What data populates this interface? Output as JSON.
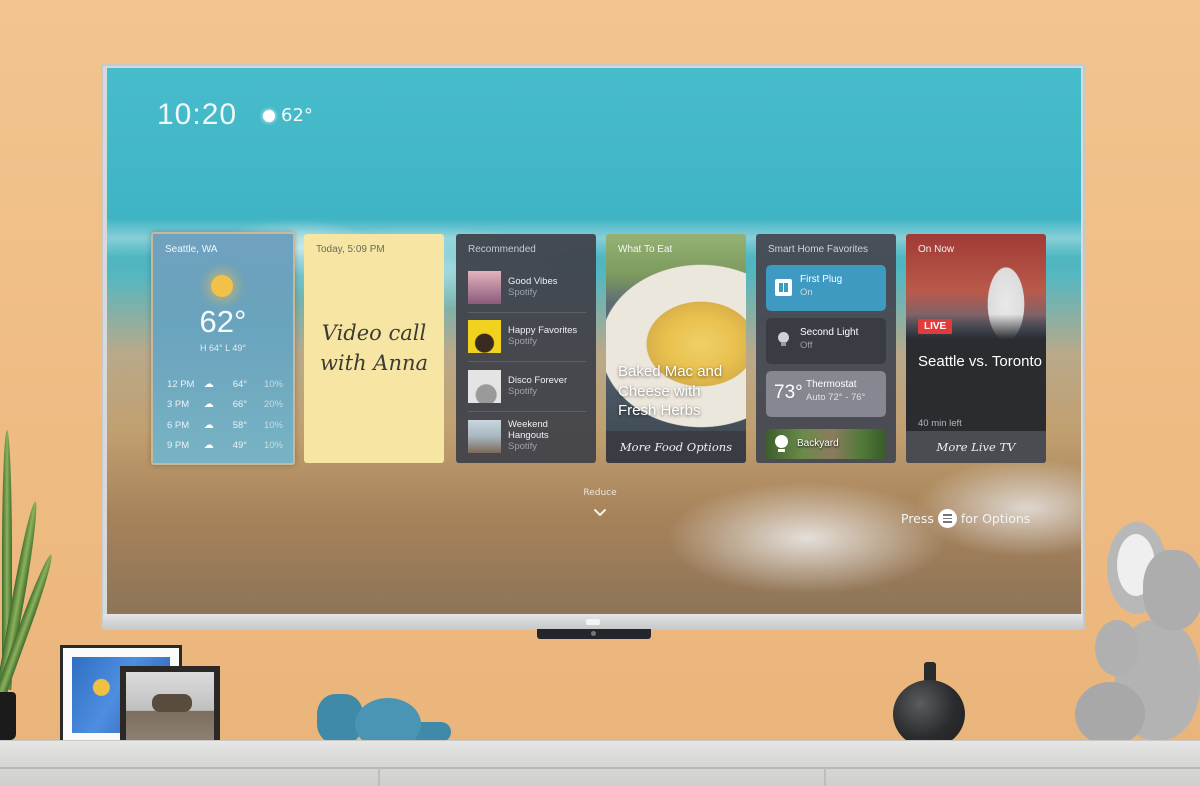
{
  "screen": {
    "clock": "10:20",
    "current_temp": "62°",
    "weather_icon": "sun-icon"
  },
  "cards": {
    "weather": {
      "location": "Seattle, WA",
      "temp": "62°",
      "high_low": "H 64°  L 49°",
      "condition_icon": "sun-icon",
      "forecast": [
        {
          "time": "12 PM",
          "icon": "cloud-icon",
          "temp": "64°",
          "precip": "10%"
        },
        {
          "time": "3 PM",
          "icon": "cloud-icon",
          "temp": "66°",
          "precip": "20%"
        },
        {
          "time": "6 PM",
          "icon": "cloud-icon",
          "temp": "58°",
          "precip": "10%"
        },
        {
          "time": "9 PM",
          "icon": "cloud-icon",
          "temp": "49°",
          "precip": "10%"
        }
      ]
    },
    "note": {
      "timestamp": "Today, 5:09 PM",
      "text": "Video call with Anna"
    },
    "recommended": {
      "title": "Recommended",
      "items": [
        {
          "title": "Good Vibes",
          "source": "Spotify",
          "cover_color": "#c58a9c"
        },
        {
          "title": "Happy Favorites",
          "source": "Spotify",
          "cover_color": "#f1d21f"
        },
        {
          "title": "Disco Forever",
          "source": "Spotify",
          "cover_color": "#d9d9d9"
        },
        {
          "title": "Weekend Hangouts",
          "source": "Spotify",
          "cover_color": "#8fa6b3"
        }
      ]
    },
    "food": {
      "title": "What To Eat",
      "dish": "Baked Mac and Cheese with Fresh Herbs",
      "footer": "More Food Options"
    },
    "smart_home": {
      "title": "Smart Home Favorites",
      "plug": {
        "name": "First Plug",
        "state": "On"
      },
      "light": {
        "name": "Second Light",
        "state": "Off"
      },
      "thermostat": {
        "temp": "73°",
        "name": "Thermostat",
        "mode": "Auto 72° - 76°"
      },
      "camera": {
        "name": "Backyard"
      }
    },
    "live_tv": {
      "title": "On Now",
      "badge": "LIVE",
      "program": "Seattle vs. Toronto",
      "time_left": "40 min left",
      "footer": "More Live TV"
    }
  },
  "reduce_label": "Reduce",
  "options_hint": {
    "prefix": "Press",
    "suffix": "for Options",
    "button_icon": "menu-button-icon"
  },
  "colors": {
    "live_red": "#e23b3b",
    "plug_on_blue": "#3e9ac0",
    "note_yellow": "#f7e6a3",
    "wall_orange": "#eebb82"
  }
}
